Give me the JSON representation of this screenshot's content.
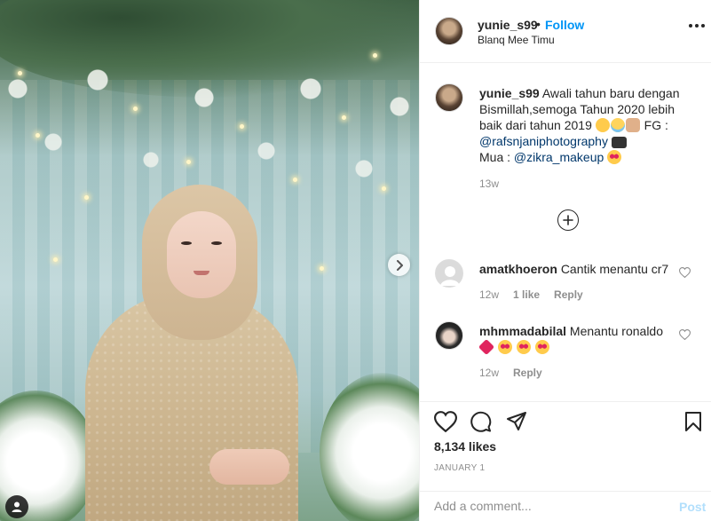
{
  "post": {
    "author": "yunie_s99",
    "follow_separator": "•",
    "follow_label": "Follow",
    "location": "Blanq Mee Timu",
    "more_icon": "more-horizontal-icon"
  },
  "caption": {
    "username": "yunie_s99",
    "text_1": " Awali tahun baru dengan Bismillah,semoga Tahun 2020 lebih baik dari tahun 2019 ",
    "text_2": " FG : ",
    "mention_1": "@rafsnjaniphotography",
    "mua_label": "Mua : ",
    "mention_2": "@zikra_makeup",
    "time": "13w"
  },
  "load_more_icon": "plus-circle-icon",
  "comments": [
    {
      "username": "amatkhoeron",
      "text": "Cantik menantu cr7",
      "time": "12w",
      "likes": "1 like",
      "reply": "Reply"
    },
    {
      "username": "mhmmadabilal",
      "text": "Menantu ronaldo",
      "time": "12w",
      "reply": "Reply"
    }
  ],
  "actions": {
    "likes": "8,134 likes",
    "date": "JANUARY 1"
  },
  "add_comment": {
    "placeholder": "Add a comment...",
    "post_label": "Post"
  },
  "colors": {
    "link_blue": "#0095f6",
    "mention_blue": "#00376b",
    "post_disabled": "#b2dffc",
    "muted": "#8e8e8e"
  }
}
